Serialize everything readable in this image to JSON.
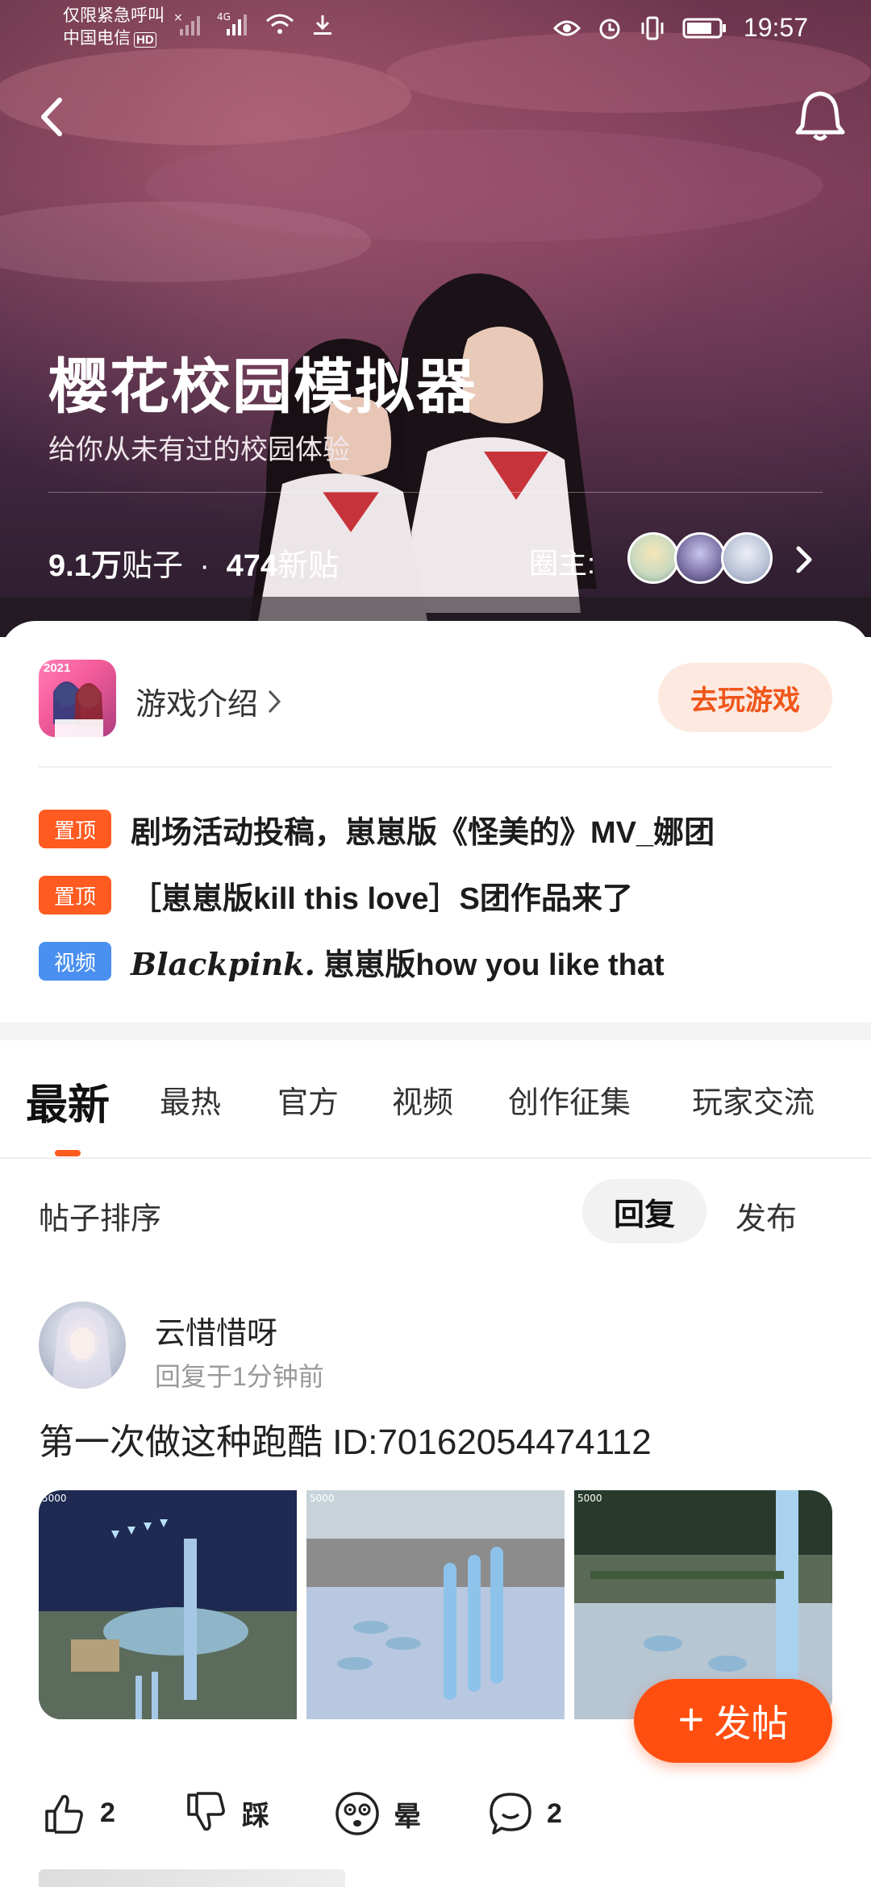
{
  "status_bar": {
    "line1": "仅限紧急呼叫",
    "carrier": "中国电信",
    "hd": "HD",
    "network": "4G",
    "time": "19:57"
  },
  "header": {
    "title": "樱花校园模拟器",
    "subtitle": "给你从未有过的校园体验",
    "posts_count": "9.1万",
    "posts_label": "贴子",
    "separator": "·",
    "new_count": "474",
    "new_label": "新贴",
    "owners_label": "圈主:"
  },
  "game": {
    "icon_year": "2021",
    "intro_label": "游戏介绍",
    "play_label": "去玩游戏"
  },
  "pinned": [
    {
      "tag": "置顶",
      "tag_type": "top",
      "text": "剧场活动投稿，崽崽版《怪美的》MV_娜团"
    },
    {
      "tag": "置顶",
      "tag_type": "top",
      "text": "［崽崽版kill this love］S团作品来了"
    },
    {
      "tag": "视频",
      "tag_type": "video",
      "script": "Blackpink.",
      "text": " 崽崽版how you like that"
    }
  ],
  "tabs": [
    "最新",
    "最热",
    "官方",
    "视频",
    "创作征集",
    "玩家交流"
  ],
  "sort": {
    "label": "帖子排序",
    "reply": "回复",
    "publish": "发布"
  },
  "post": {
    "author": "云惜惜呀",
    "time": "回复于1分钟前",
    "text": "第一次做这种跑酷 ID:70162054474112",
    "thumb_badge": "5000",
    "likes": "2",
    "dislike_label": "踩",
    "dizzy_label": "晕",
    "comments": "2"
  },
  "fab_label": "发帖",
  "colors": {
    "accent": "#ff5a1f",
    "video_tag": "#4a90f0",
    "play_bg": "#fde9e0"
  }
}
